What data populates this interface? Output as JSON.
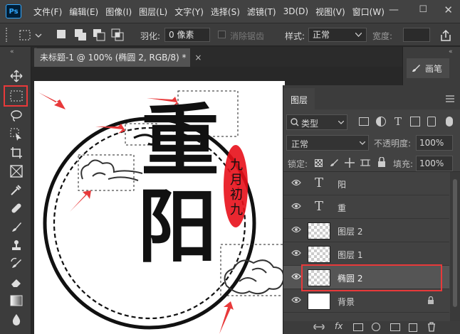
{
  "app": {
    "logo": "Ps"
  },
  "menu": [
    "文件(F)",
    "编辑(E)",
    "图像(I)",
    "图层(L)",
    "文字(Y)",
    "选择(S)",
    "滤镜(T)",
    "3D(D)",
    "视图(V)",
    "窗口(W)"
  ],
  "window_controls": {
    "minimize": "—",
    "maximize": "☐",
    "close": "✕"
  },
  "options_bar": {
    "feather_label": "羽化:",
    "feather_value": "0 像素",
    "antialias_label": "消除锯齿",
    "style_label": "样式:",
    "style_value": "正常",
    "width_label": "宽度:"
  },
  "document_tab": {
    "title": "未标题-1 @ 100% (椭圆 2, RGB/8) *",
    "close": "×"
  },
  "side_panel": {
    "brush_label": "画笔"
  },
  "layers_panel": {
    "tab_label": "图层",
    "filter_kind": "类型",
    "blend_mode": "正常",
    "opacity_label": "不透明度:",
    "opacity_value": "100%",
    "lock_label": "锁定:",
    "fill_label": "填充:",
    "fill_value": "100%",
    "layers": [
      {
        "name": "阳",
        "type": "text",
        "selected": false
      },
      {
        "name": "重",
        "type": "text",
        "selected": false
      },
      {
        "name": "图层 2",
        "type": "pixel",
        "selected": false
      },
      {
        "name": "图层 1",
        "type": "pixel",
        "selected": false
      },
      {
        "name": "椭圆 2",
        "type": "shape",
        "selected": true
      },
      {
        "name": "背景",
        "type": "background",
        "selected": false,
        "locked": true
      }
    ],
    "footer_fx": "fx"
  },
  "artwork": {
    "char_top": "重",
    "char_bottom": "阳",
    "seal_text": [
      "九",
      "月",
      "初",
      "九"
    ]
  },
  "colors": {
    "highlight_red": "#e8393a",
    "accent_blue": "#31a8ff",
    "seal_red": "#e8101a"
  }
}
